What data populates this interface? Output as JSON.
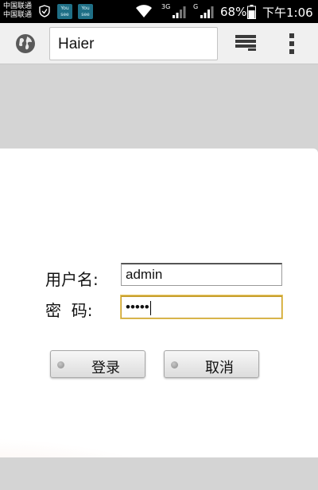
{
  "status_bar": {
    "carrier_line1": "中国联通",
    "carrier_line2": "中国联通",
    "app_tile_text": "You see",
    "net_3g": "3G",
    "net_g": "G",
    "battery_percent": "68%",
    "battery_level": 0.68,
    "time": "下午1:06",
    "icons": [
      "shield-icon",
      "app-icon",
      "app-icon",
      "wifi-icon",
      "signal-icon",
      "signal-icon",
      "battery-icon"
    ]
  },
  "toolbar": {
    "url": "Haier",
    "icons": [
      "globe-icon",
      "tabs-icon",
      "overflow-menu-icon"
    ]
  },
  "login": {
    "username_label": "用户名:",
    "password_label": "密  码:",
    "username_value": "admin",
    "password_value": "•••••",
    "login_button": "登录",
    "cancel_button": "取消"
  },
  "colors": {
    "status_bar_bg": "#000000",
    "toolbar_bg": "#f0f0f0",
    "page_bg": "#d4d4d4",
    "focus_border": "#c8a030",
    "gradient_accent": "#d6371c"
  }
}
